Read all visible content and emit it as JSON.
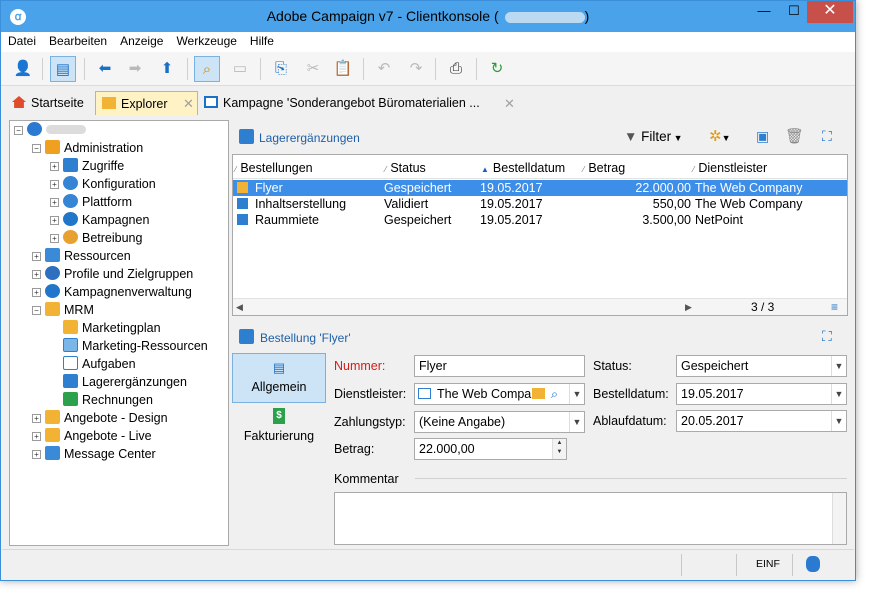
{
  "window": {
    "title": "Adobe Campaign v7 - Clientkonsole (",
    "title_end": ")"
  },
  "menu": [
    "Datei",
    "Bearbeiten",
    "Anzeige",
    "Werkzeuge",
    "Hilfe"
  ],
  "tabs": {
    "home": "Startseite",
    "explorer": "Explorer",
    "campaign": "Kampagne 'Sonderangebot Büromaterialien ...",
    "close": "✕"
  },
  "tree": {
    "root": "",
    "administration": "Administration",
    "zugriffe": "Zugriffe",
    "konfiguration": "Konfiguration",
    "plattform": "Plattform",
    "kampagnen": "Kampagnen",
    "betreibung": "Betreibung",
    "ressourcen": "Ressourcen",
    "profile": "Profile und Zielgruppen",
    "kampagnenverwaltung": "Kampagnenverwaltung",
    "mrm": "MRM",
    "marketingplan": "Marketingplan",
    "marketing_ressourcen": "Marketing-Ressourcen",
    "aufgaben": "Aufgaben",
    "lagererg": "Lagerergänzungen",
    "rechnungen": "Rechnungen",
    "angebote_design": "Angebote - Design",
    "angebote_live": "Angebote - Live",
    "message_center": "Message Center"
  },
  "list": {
    "title": "Lagerergänzungen",
    "filter": "Filter",
    "columns": [
      "Bestellungen",
      "Status",
      "Bestelldatum",
      "Betrag",
      "Dienstleister"
    ],
    "rows": [
      {
        "name": "Flyer",
        "status": "Gespeichert",
        "date": "19.05.2017",
        "amount": "22.000,00",
        "provider": "The Web Company"
      },
      {
        "name": "Inhaltserstellung",
        "status": "Validiert",
        "date": "19.05.2017",
        "amount": "550,00",
        "provider": "The Web Company"
      },
      {
        "name": "Raummiete",
        "status": "Gespeichert",
        "date": "19.05.2017",
        "amount": "3.500,00",
        "provider": "NetPoint"
      }
    ],
    "pager": "3 / 3"
  },
  "detail": {
    "title": "Bestellung 'Flyer'",
    "side_general": "Allgemein",
    "side_billing": "Fakturierung",
    "nummer_label": "Nummer:",
    "nummer": "Flyer",
    "dienstleister_label": "Dienstleister:",
    "dienstleister": "The Web Compa",
    "zahlungstyp_label": "Zahlungstyp:",
    "zahlungstyp": "(Keine Angabe)",
    "betrag_label": "Betrag:",
    "betrag": "22.000,00",
    "status_label": "Status:",
    "status": "Gespeichert",
    "bestelldatum_label": "Bestelldatum:",
    "bestelldatum": "19.05.2017",
    "ablaufdatum_label": "Ablaufdatum:",
    "ablaufdatum": "20.05.2017",
    "kommentar_label": "Kommentar"
  },
  "status": {
    "mode": "EINF"
  }
}
